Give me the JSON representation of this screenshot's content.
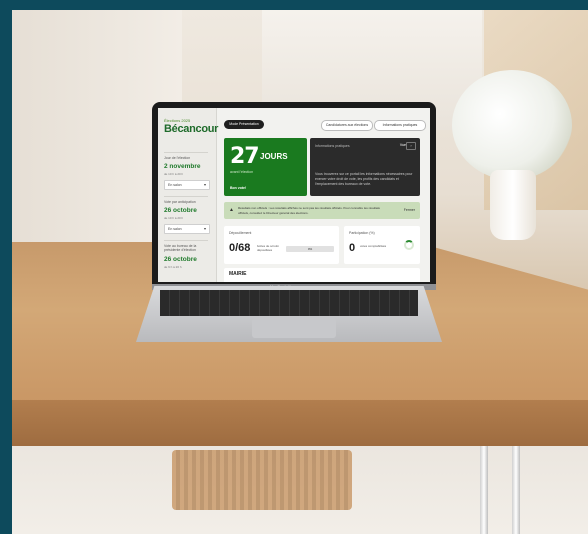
{
  "sidebar": {
    "logo_small": "Élections 2025",
    "logo": "Bécancour",
    "section1_label": "Jour de l'élection",
    "section1_date": "2 novembre",
    "section1_sub": "de 10 h à 20 h",
    "select1": "En salon",
    "section2_label": "Vote par anticipation",
    "section2_date": "26 octobre",
    "section2_sub": "de 10 h à 20 h",
    "select2": "En salon",
    "section3_label": "Vote au bureau de la présidente d'élection",
    "section3_date": "26 octobre",
    "section3_sub": "de 9 h à 20 h"
  },
  "topbar": {
    "left_button": "Mode Présentation",
    "btn_candidates": "Candidatures aux élections",
    "btn_info": "Informations pratiques"
  },
  "countdown": {
    "number": "27",
    "unit": "JOURS",
    "sub": "avant l'élection",
    "link": "Bon vote!"
  },
  "info_card": {
    "title": "Informations pratiques",
    "vue": "Vue",
    "text": "Vous trouverez sur ce portail les informations nécessaires pour exercer votre droit de vote, les profils des candidats et l'emplacement des bureaux de vote."
  },
  "alert": {
    "text": "Résultats non officiels : Les résultats affichés ne sont pas les résultats officiels. Pour connaître les résultats officiels, consultez le Directeur général des élections.",
    "close": "Fermer"
  },
  "depouillement": {
    "title": "Dépouillement",
    "count": "0/68",
    "label": "boîtes de scrutin dépouillées",
    "percent_text": "0%",
    "percent": 0
  },
  "participation": {
    "title": "Participation (%)",
    "value": "0",
    "label": "votes comptabilisés"
  },
  "section_title": "MAIRIE",
  "laptop_model": "MacBook Air"
}
